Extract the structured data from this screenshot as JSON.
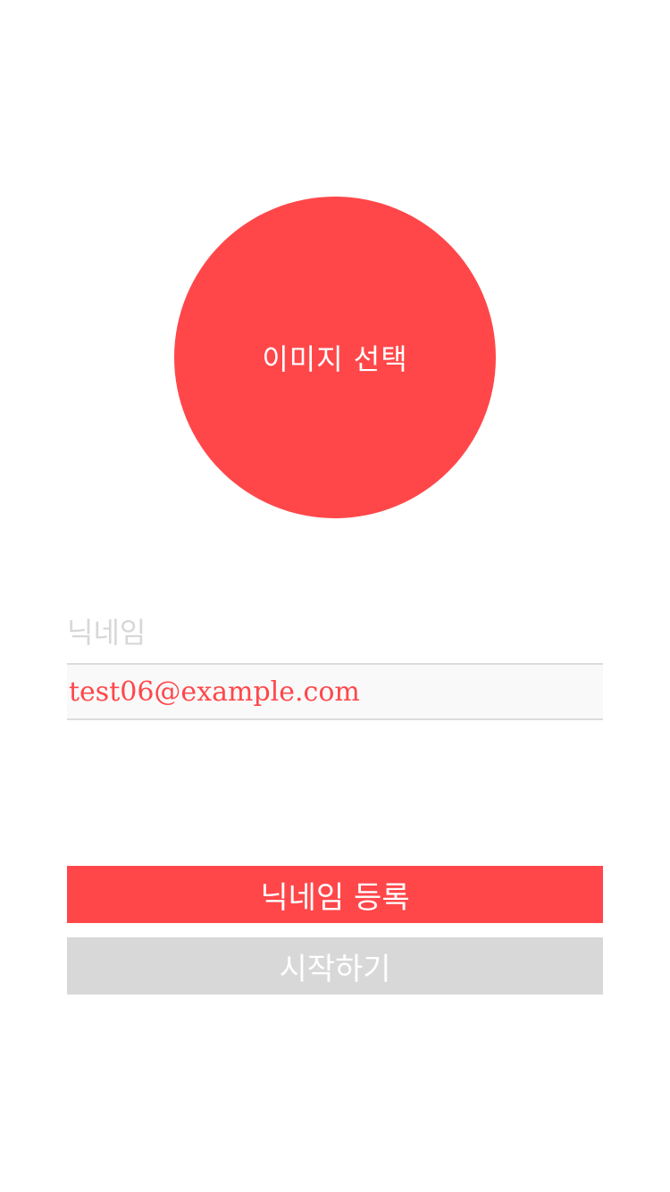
{
  "colors": {
    "accent": "#ff474a",
    "disabled": "#d8d8d8",
    "placeholder": "#d7d7d7",
    "field_background": "#f9f9f9"
  },
  "profile": {
    "image_picker_label": "이미지 선택"
  },
  "nickname": {
    "label": "닉네임",
    "value": "test06@example.com"
  },
  "actions": {
    "register_label": "닉네임 등록",
    "start_label": "시작하기"
  }
}
